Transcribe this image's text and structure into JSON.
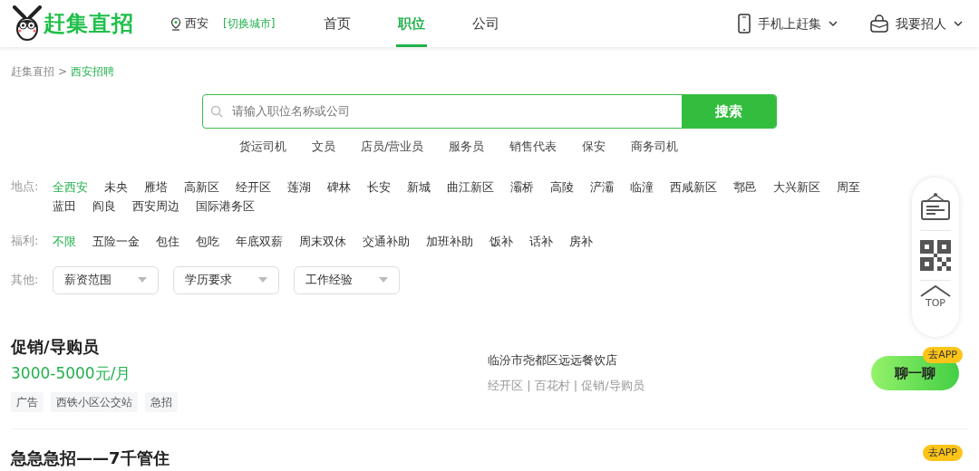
{
  "header": {
    "logo_text": "赶集直招",
    "city": "西安",
    "switch_city": "[切换城市]",
    "nav": [
      {
        "label": "首页",
        "selected": false
      },
      {
        "label": "职位",
        "selected": true
      },
      {
        "label": "公司",
        "selected": false
      }
    ],
    "right_menus": [
      {
        "kind": "phone",
        "label": "手机上赶集"
      },
      {
        "kind": "bag",
        "label": "我要招人"
      }
    ]
  },
  "breadcrumb": {
    "separator": ">",
    "items": [
      {
        "label": "赶集直招",
        "current": false
      },
      {
        "label": "西安招聘",
        "current": true
      }
    ]
  },
  "search": {
    "placeholder": "请输入职位名称或公司",
    "button": "搜索"
  },
  "hot_keywords": [
    "货运司机",
    "文员",
    "店员/营业员",
    "服务员",
    "销售代表",
    "保安",
    "商务司机"
  ],
  "filters": [
    {
      "label": "地点:",
      "options": [
        {
          "label": "全西安",
          "selected": true
        },
        {
          "label": "未央",
          "selected": false
        },
        {
          "label": "雁塔",
          "selected": false
        },
        {
          "label": "高新区",
          "selected": false
        },
        {
          "label": "经开区",
          "selected": false
        },
        {
          "label": "莲湖",
          "selected": false
        },
        {
          "label": "碑林",
          "selected": false
        },
        {
          "label": "长安",
          "selected": false
        },
        {
          "label": "新城",
          "selected": false
        },
        {
          "label": "曲江新区",
          "selected": false
        },
        {
          "label": "灞桥",
          "selected": false
        },
        {
          "label": "高陵",
          "selected": false
        },
        {
          "label": "浐灞",
          "selected": false
        },
        {
          "label": "临潼",
          "selected": false
        },
        {
          "label": "西咸新区",
          "selected": false
        },
        {
          "label": "鄠邑",
          "selected": false
        },
        {
          "label": "大兴新区",
          "selected": false
        },
        {
          "label": "周至",
          "selected": false
        },
        {
          "label": "蓝田",
          "selected": false
        },
        {
          "label": "阎良",
          "selected": false
        },
        {
          "label": "西安周边",
          "selected": false
        },
        {
          "label": "国际港务区",
          "selected": false
        }
      ]
    },
    {
      "label": "福利:",
      "options": [
        {
          "label": "不限",
          "selected": true
        },
        {
          "label": "五险一金",
          "selected": false
        },
        {
          "label": "包住",
          "selected": false
        },
        {
          "label": "包吃",
          "selected": false
        },
        {
          "label": "年底双薪",
          "selected": false
        },
        {
          "label": "周末双休",
          "selected": false
        },
        {
          "label": "交通补助",
          "selected": false
        },
        {
          "label": "加班补助",
          "selected": false
        },
        {
          "label": "饭补",
          "selected": false
        },
        {
          "label": "话补",
          "selected": false
        },
        {
          "label": "房补",
          "selected": false
        }
      ]
    }
  ],
  "other_filter": {
    "label": "其他:",
    "dropdowns": [
      "薪资范围",
      "学历要求",
      "工作经验"
    ]
  },
  "float_toolbar": {
    "top_label": "TOP"
  },
  "jobs": [
    {
      "title": "促销/导购员",
      "salary": "3000-5000元/月",
      "tags": [
        "广告",
        "西铁小区公交站",
        "急招"
      ],
      "company": "临汾市尧都区远远餐饮店",
      "details": "经开区 | 百花村 | 促销/导购员",
      "chat_button": "聊一聊",
      "app_badge": "去APP"
    },
    {
      "title": "急急急招——7千管住",
      "app_badge": "去APP"
    }
  ]
}
